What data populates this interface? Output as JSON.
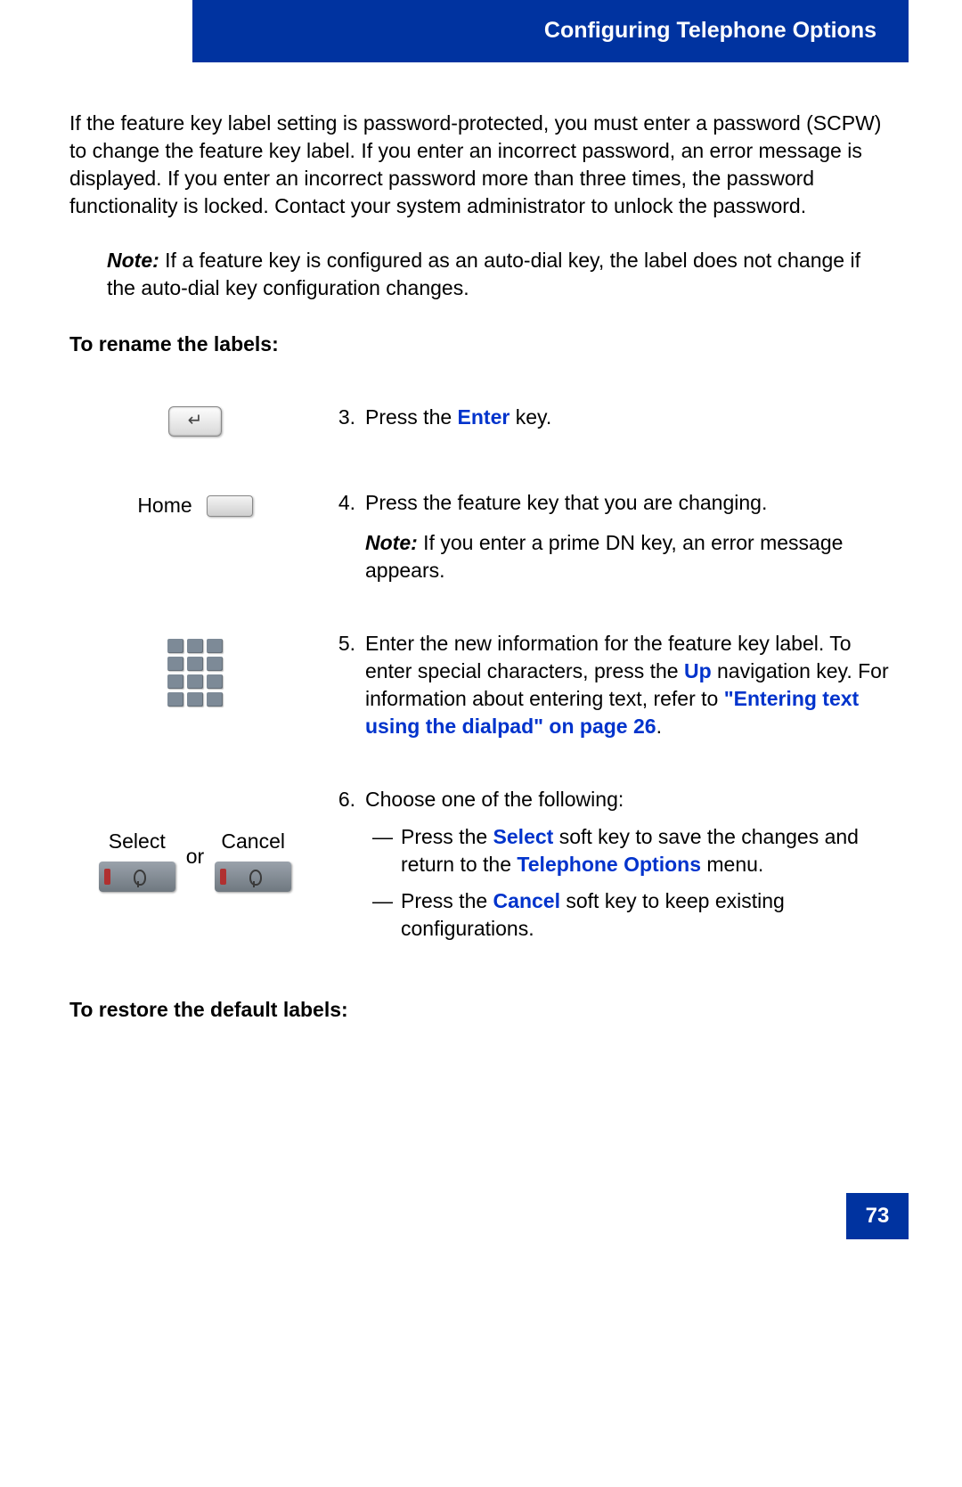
{
  "header": {
    "title": "Configuring Telephone Options"
  },
  "intro": "If the feature key label setting is password-protected, you must enter a password (SCPW) to change the feature key label. If you enter an incorrect password, an error message is displayed. If you enter an incorrect password more than three times, the password functionality is locked. Contact your system administrator to unlock the password.",
  "note1": {
    "label": "Note:",
    "text": " If a feature key is configured as an auto-dial key, the label does not change if the auto-dial key configuration changes."
  },
  "heading_rename": "To rename the labels:",
  "steps": {
    "s3": {
      "num": "3.",
      "pre": "Press the ",
      "link": "Enter",
      "post": " key."
    },
    "s4": {
      "num": "4.",
      "home_label": "Home",
      "text": "Press the feature key that you are changing.",
      "note_label": "Note:",
      "note_text": " If you enter a prime DN key, an error message appears."
    },
    "s5": {
      "num": "5.",
      "t1": "Enter the new information for the feature key label. To enter special characters, press the ",
      "up": "Up",
      "t2": " navigation key. For information about entering text, refer to ",
      "xref": "\"Entering text using the dialpad\" on page 26",
      "t3": "."
    },
    "s6": {
      "num": "6.",
      "lead": "Choose one of the following:",
      "select_label": "Select",
      "cancel_label": "Cancel",
      "or": "or",
      "opt1_a": "Press the ",
      "opt1_select": "Select",
      "opt1_b": " soft key to save the changes and return to the ",
      "opt1_menu": "Telephone Options",
      "opt1_c": " menu.",
      "opt2_a": "Press the ",
      "opt2_cancel": "Cancel",
      "opt2_b": " soft key to keep existing configurations."
    }
  },
  "heading_restore": "To restore the default labels:",
  "page_number": "73"
}
